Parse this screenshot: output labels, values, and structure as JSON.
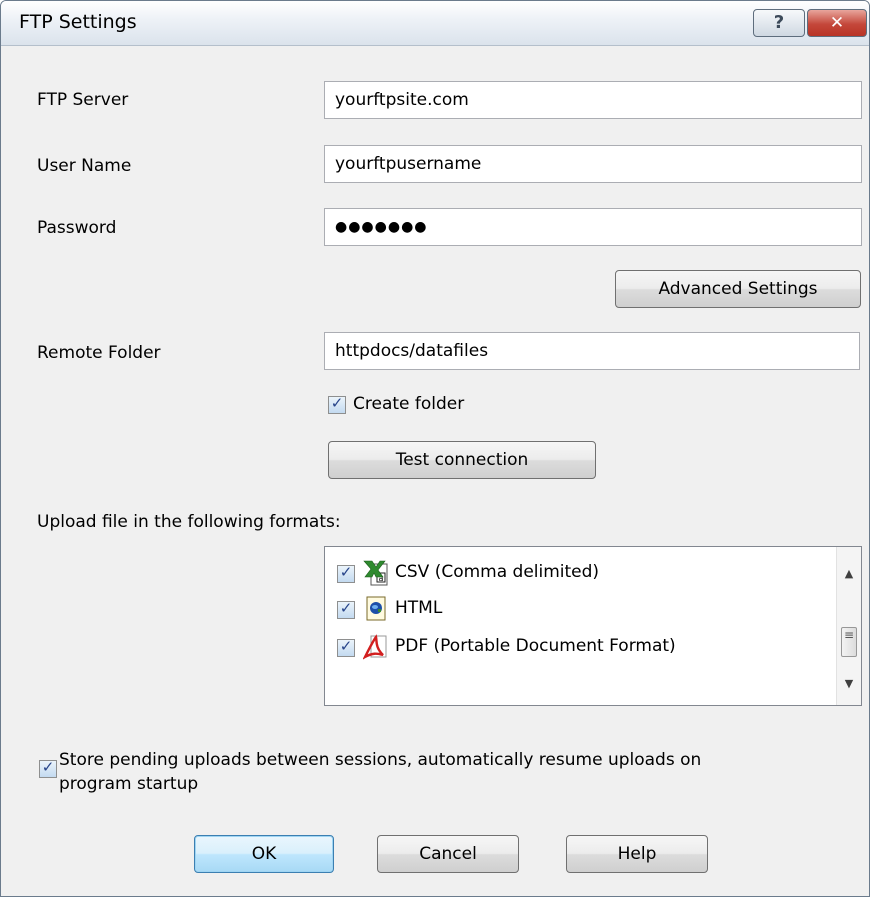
{
  "window": {
    "title": "FTP Settings",
    "help_glyph": "?",
    "close_glyph": "✕"
  },
  "fields": {
    "ftp_server": {
      "label": "FTP Server",
      "value": "yourftpsite.com"
    },
    "user_name": {
      "label": "User Name",
      "value": "yourftpusername"
    },
    "password": {
      "label": "Password",
      "value": "●●●●●●●"
    },
    "remote_folder": {
      "label": "Remote Folder",
      "value": "httpdocs/datafiles"
    }
  },
  "buttons": {
    "advanced": "Advanced Settings",
    "test": "Test connection",
    "ok": "OK",
    "cancel": "Cancel",
    "help": "Help"
  },
  "create_folder": {
    "label": "Create folder",
    "checked": true
  },
  "formats": {
    "heading": "Upload file in the following formats:",
    "items": [
      {
        "label": "CSV (Comma delimited)",
        "checked": true,
        "icon": "excel-csv-icon"
      },
      {
        "label": "HTML",
        "checked": true,
        "icon": "html-globe-icon"
      },
      {
        "label": "PDF (Portable Document Format)",
        "checked": true,
        "icon": "pdf-icon"
      }
    ]
  },
  "store_pending": {
    "line1": "Store pending uploads between sessions, automatically resume uploads on",
    "line2": "program startup",
    "checked": true
  },
  "check_glyph": "✓"
}
